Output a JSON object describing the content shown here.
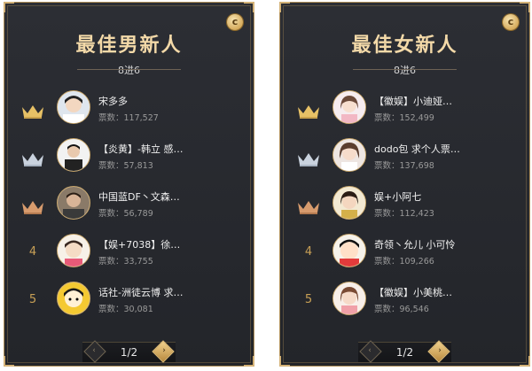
{
  "panels": [
    {
      "title": "最佳男新人",
      "subtitle": "8进6",
      "coin": "c",
      "entries": [
        {
          "rank": "",
          "crown": "gold",
          "name": "宋多多",
          "votes": "票数：117,527"
        },
        {
          "rank": "",
          "crown": "silver",
          "name": "【炎黄】-韩立 感…",
          "votes": "票数：57,813"
        },
        {
          "rank": "",
          "crown": "bronze",
          "name": "中国蓝DF丶文森…",
          "votes": "票数：56,789"
        },
        {
          "rank": "4",
          "crown": "",
          "name": "【娱+7038】徐…",
          "votes": "票数：33,755"
        },
        {
          "rank": "5",
          "crown": "",
          "name": "话社-洲徒云博 求…",
          "votes": "票数：30,081"
        }
      ],
      "page": "1/2"
    },
    {
      "title": "最佳女新人",
      "subtitle": "8进6",
      "coin": "c",
      "entries": [
        {
          "rank": "",
          "crown": "gold",
          "name": "【徽娱】小迪娅…",
          "votes": "票数：152,499"
        },
        {
          "rank": "",
          "crown": "silver",
          "name": "dodo包 求个人票…",
          "votes": "票数：137,698"
        },
        {
          "rank": "",
          "crown": "bronze",
          "name": "娱+小阿七",
          "votes": "票数：112,423"
        },
        {
          "rank": "4",
          "crown": "",
          "name": "奇领丶允儿 小可怜",
          "votes": "票数：109,266"
        },
        {
          "rank": "5",
          "crown": "",
          "name": "【徽娱】小美桃…",
          "votes": "票数：96,546"
        }
      ],
      "page": "1/2"
    }
  ],
  "colors": {
    "gold_crown": "#e7c166",
    "silver_crown": "#c9d2de",
    "bronze_crown": "#d79b6d",
    "accent": "#c8a056"
  },
  "icons": {
    "prev": "‹",
    "next": "›"
  }
}
